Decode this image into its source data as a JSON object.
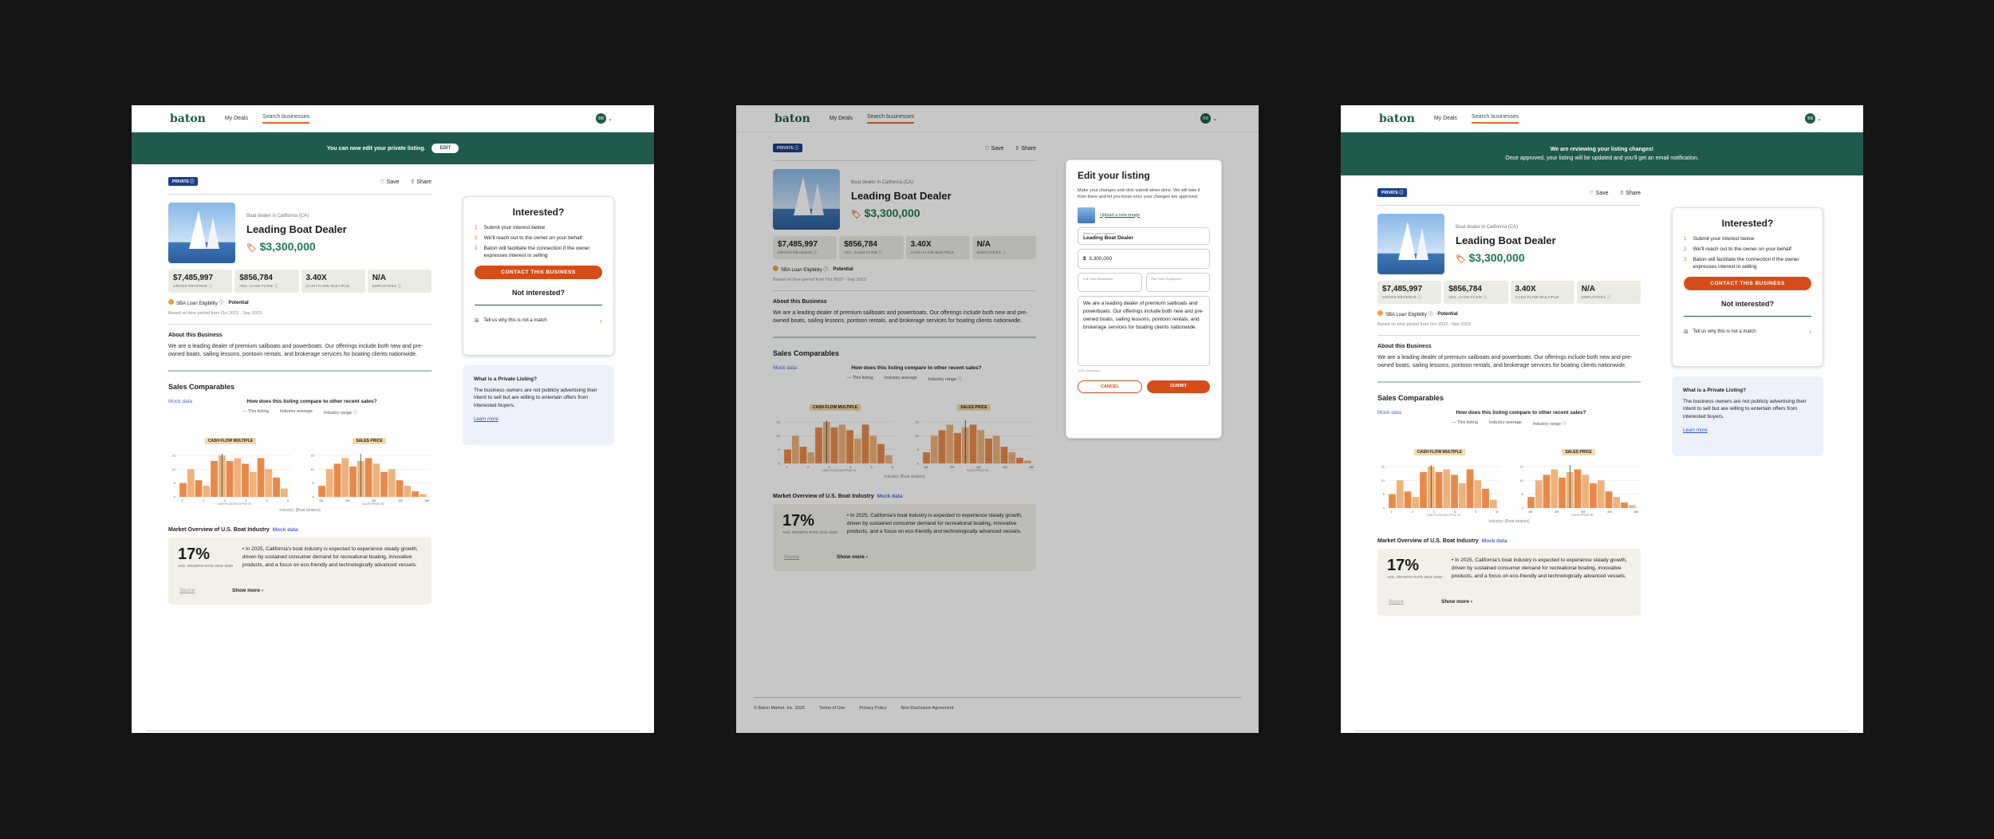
{
  "nav": {
    "logo": "baton",
    "links": [
      "My Deals",
      "Search businesses"
    ],
    "avatar": "BB"
  },
  "banner1": {
    "text": "You can now edit your private listing.",
    "edit": "EDIT"
  },
  "banner3": {
    "line1": "We are reviewing your listing changes!",
    "line2": "Once approved, your listing will be updated and you'll get an email notification."
  },
  "listing": {
    "badge": "PRIVATE ⓘ",
    "save": "♡ Save",
    "share": "⇧ Share",
    "subtitle": "Boat dealer in California (CA)",
    "title": "Leading Boat Dealer",
    "price": "$3,300,000",
    "metrics": [
      {
        "v": "$7,485,997",
        "l": "GROSS REVENUE ⓘ"
      },
      {
        "v": "$856,784",
        "l": "ADJ. CASH FLOW ⓘ"
      },
      {
        "v": "3.40X",
        "l": "CASH FLOW MULTIPLE"
      },
      {
        "v": "N/A",
        "l": "EMPLOYEES ⓘ"
      }
    ],
    "sba": "SBA Loan Eligibility ⓘ",
    "potential": "Potential",
    "period": "Based on time period from Oct 2022 - Sep 2023",
    "about_h": "About this Business",
    "about": "We are a leading dealer of premium sailboats and powerboats. Our offerings include both new and pre-owned boats, sailing lessons, pontoon rentals, and brokerage services for boating clients nationwide.",
    "comp_h": "Sales Comparables",
    "mock": "Mock data",
    "q": "How does this listing compare to other recent sales?",
    "legend": [
      "— This listing",
      "Industry average",
      "Industry range ⓘ"
    ],
    "chart1": "CASH FLOW MULTIPLE",
    "chart2": "SALES PRICE",
    "xl1": "CASH FLOW MULTIPLE (X)",
    "xl2": "SALES PRICE ($)",
    "yl": "FREQUENCY",
    "industry": "Industry: [Boat dealers]",
    "mk_h": "Market Overview of U.S. Boat Industry",
    "growth": "17%",
    "growth_l": "AVG. GROWTH RATE 2024–2029",
    "mk_text": "In 2025, California's boat industry is expected to experience steady growth, driven by sustained consumer demand for recreational boating, innovative products, and a focus on eco-friendly and technologically advanced vessels.",
    "source": "Source",
    "showmore": "Show more ›"
  },
  "interested": {
    "title": "Interested?",
    "steps": [
      "Submit your interest below",
      "We'll reach out to the owner on your behalf",
      "Baton will facilitate the connection if the owner expresses interest in selling"
    ],
    "cta": "CONTACT THIS BUSINESS",
    "not": "Not interested?",
    "tell": "Tell us why this is not a match"
  },
  "private": {
    "title": "What is a Private Listing?",
    "text": "The business owners are not publicly advertising their intent to sell but are willing to entertain offers from interested buyers.",
    "link": "Learn more"
  },
  "edit": {
    "title": "Edit your listing",
    "desc": "Make your changes and click submit when done. We will take it from there and let you know once your changes are approved.",
    "upload": "Upload a new image",
    "name_label": "What is your business?",
    "name": "Leading Boat Dealer",
    "price": "3,300,000",
    "ft": "Full Time Employees",
    "pt": "Part Time Employees",
    "count": "1000 characters",
    "cancel": "CANCEL",
    "submit": "SUBMIT"
  },
  "footer": [
    "© Baton Market, Inc. 2025",
    "Terms of Use",
    "Privacy Policy",
    "Non-Disclosure Agreement"
  ],
  "chart_data": [
    {
      "type": "bar",
      "title": "CASH FLOW MULTIPLE",
      "xlabel": "CASH FLOW MULTIPLE (X)",
      "ylabel": "FREQUENCY",
      "x_ticks": [
        "1",
        "2",
        "3",
        "4",
        "5",
        "6"
      ],
      "values": [
        5,
        10,
        6,
        4,
        13,
        15,
        13,
        14,
        12,
        9,
        14,
        10,
        7,
        3
      ],
      "ylim": [
        0,
        15
      ]
    },
    {
      "type": "bar",
      "title": "SALES PRICE",
      "xlabel": "SALES PRICE ($)",
      "ylabel": "FREQUENCY",
      "x_ticks": [
        "1M",
        "2M",
        "3M",
        "4M",
        "5M"
      ],
      "values": [
        4,
        10,
        12,
        14,
        11,
        13,
        14,
        12,
        9,
        10,
        6,
        4,
        2,
        1
      ],
      "ylim": [
        0,
        15
      ]
    }
  ]
}
